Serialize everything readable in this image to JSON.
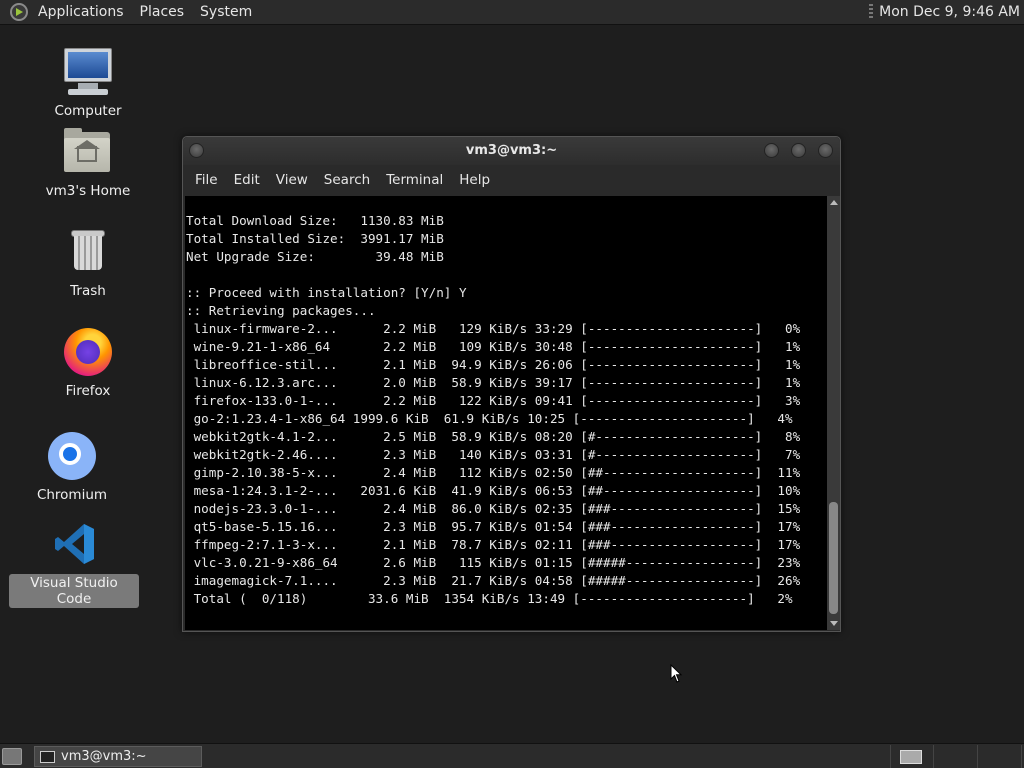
{
  "top_panel": {
    "menus": [
      "Applications",
      "Places",
      "System"
    ],
    "clock": "Mon Dec 9,  9:46 AM"
  },
  "desktop_icons": [
    {
      "label": "Computer",
      "icon": "computer-icon"
    },
    {
      "label": "vm3's Home",
      "icon": "home-folder-icon"
    },
    {
      "label": "Trash",
      "icon": "trash-icon"
    },
    {
      "label": "Firefox",
      "icon": "firefox-icon"
    },
    {
      "label": "Chromium",
      "icon": "chromium-icon"
    },
    {
      "label": "Visual Studio Code",
      "icon": "vscode-icon",
      "selected": true
    }
  ],
  "terminal": {
    "title": "vm3@vm3:~",
    "menu": [
      "File",
      "Edit",
      "View",
      "Search",
      "Terminal",
      "Help"
    ],
    "lines": [
      "Total Download Size:   1130.83 MiB",
      "Total Installed Size:  3991.17 MiB",
      "Net Upgrade Size:        39.48 MiB",
      "",
      ":: Proceed with installation? [Y/n] Y",
      ":: Retrieving packages...",
      " linux-firmware-2...      2.2 MiB   129 KiB/s 33:29 [----------------------]   0%",
      " wine-9.21-1-x86_64       2.2 MiB   109 KiB/s 30:48 [----------------------]   1%",
      " libreoffice-stil...      2.1 MiB  94.9 KiB/s 26:06 [----------------------]   1%",
      " linux-6.12.3.arc...      2.0 MiB  58.9 KiB/s 39:17 [----------------------]   1%",
      " firefox-133.0-1-...      2.2 MiB   122 KiB/s 09:41 [----------------------]   3%",
      " go-2:1.23.4-1-x86_64 1999.6 KiB  61.9 KiB/s 10:25 [----------------------]   4%",
      " webkit2gtk-4.1-2...      2.5 MiB  58.9 KiB/s 08:20 [#---------------------]   8%",
      " webkit2gtk-2.46....      2.3 MiB   140 KiB/s 03:31 [#---------------------]   7%",
      " gimp-2.10.38-5-x...      2.4 MiB   112 KiB/s 02:50 [##--------------------]  11%",
      " mesa-1:24.3.1-2-...   2031.6 KiB  41.9 KiB/s 06:53 [##--------------------]  10%",
      " nodejs-23.3.0-1-...      2.4 MiB  86.0 KiB/s 02:35 [###-------------------]  15%",
      " qt5-base-5.15.16...      2.3 MiB  95.7 KiB/s 01:54 [###-------------------]  17%",
      " ffmpeg-2:7.1-3-x...      2.1 MiB  78.7 KiB/s 02:11 [###-------------------]  17%",
      " vlc-3.0.21-9-x86_64      2.6 MiB   115 KiB/s 01:15 [#####-----------------]  23%",
      " imagemagick-7.1....      2.3 MiB  21.7 KiB/s 04:58 [#####-----------------]  26%",
      " Total (  0/118)        33.6 MiB  1354 KiB/s 13:49 [----------------------]   2%"
    ]
  },
  "taskbar": {
    "window_button": "vm3@vm3:~"
  }
}
